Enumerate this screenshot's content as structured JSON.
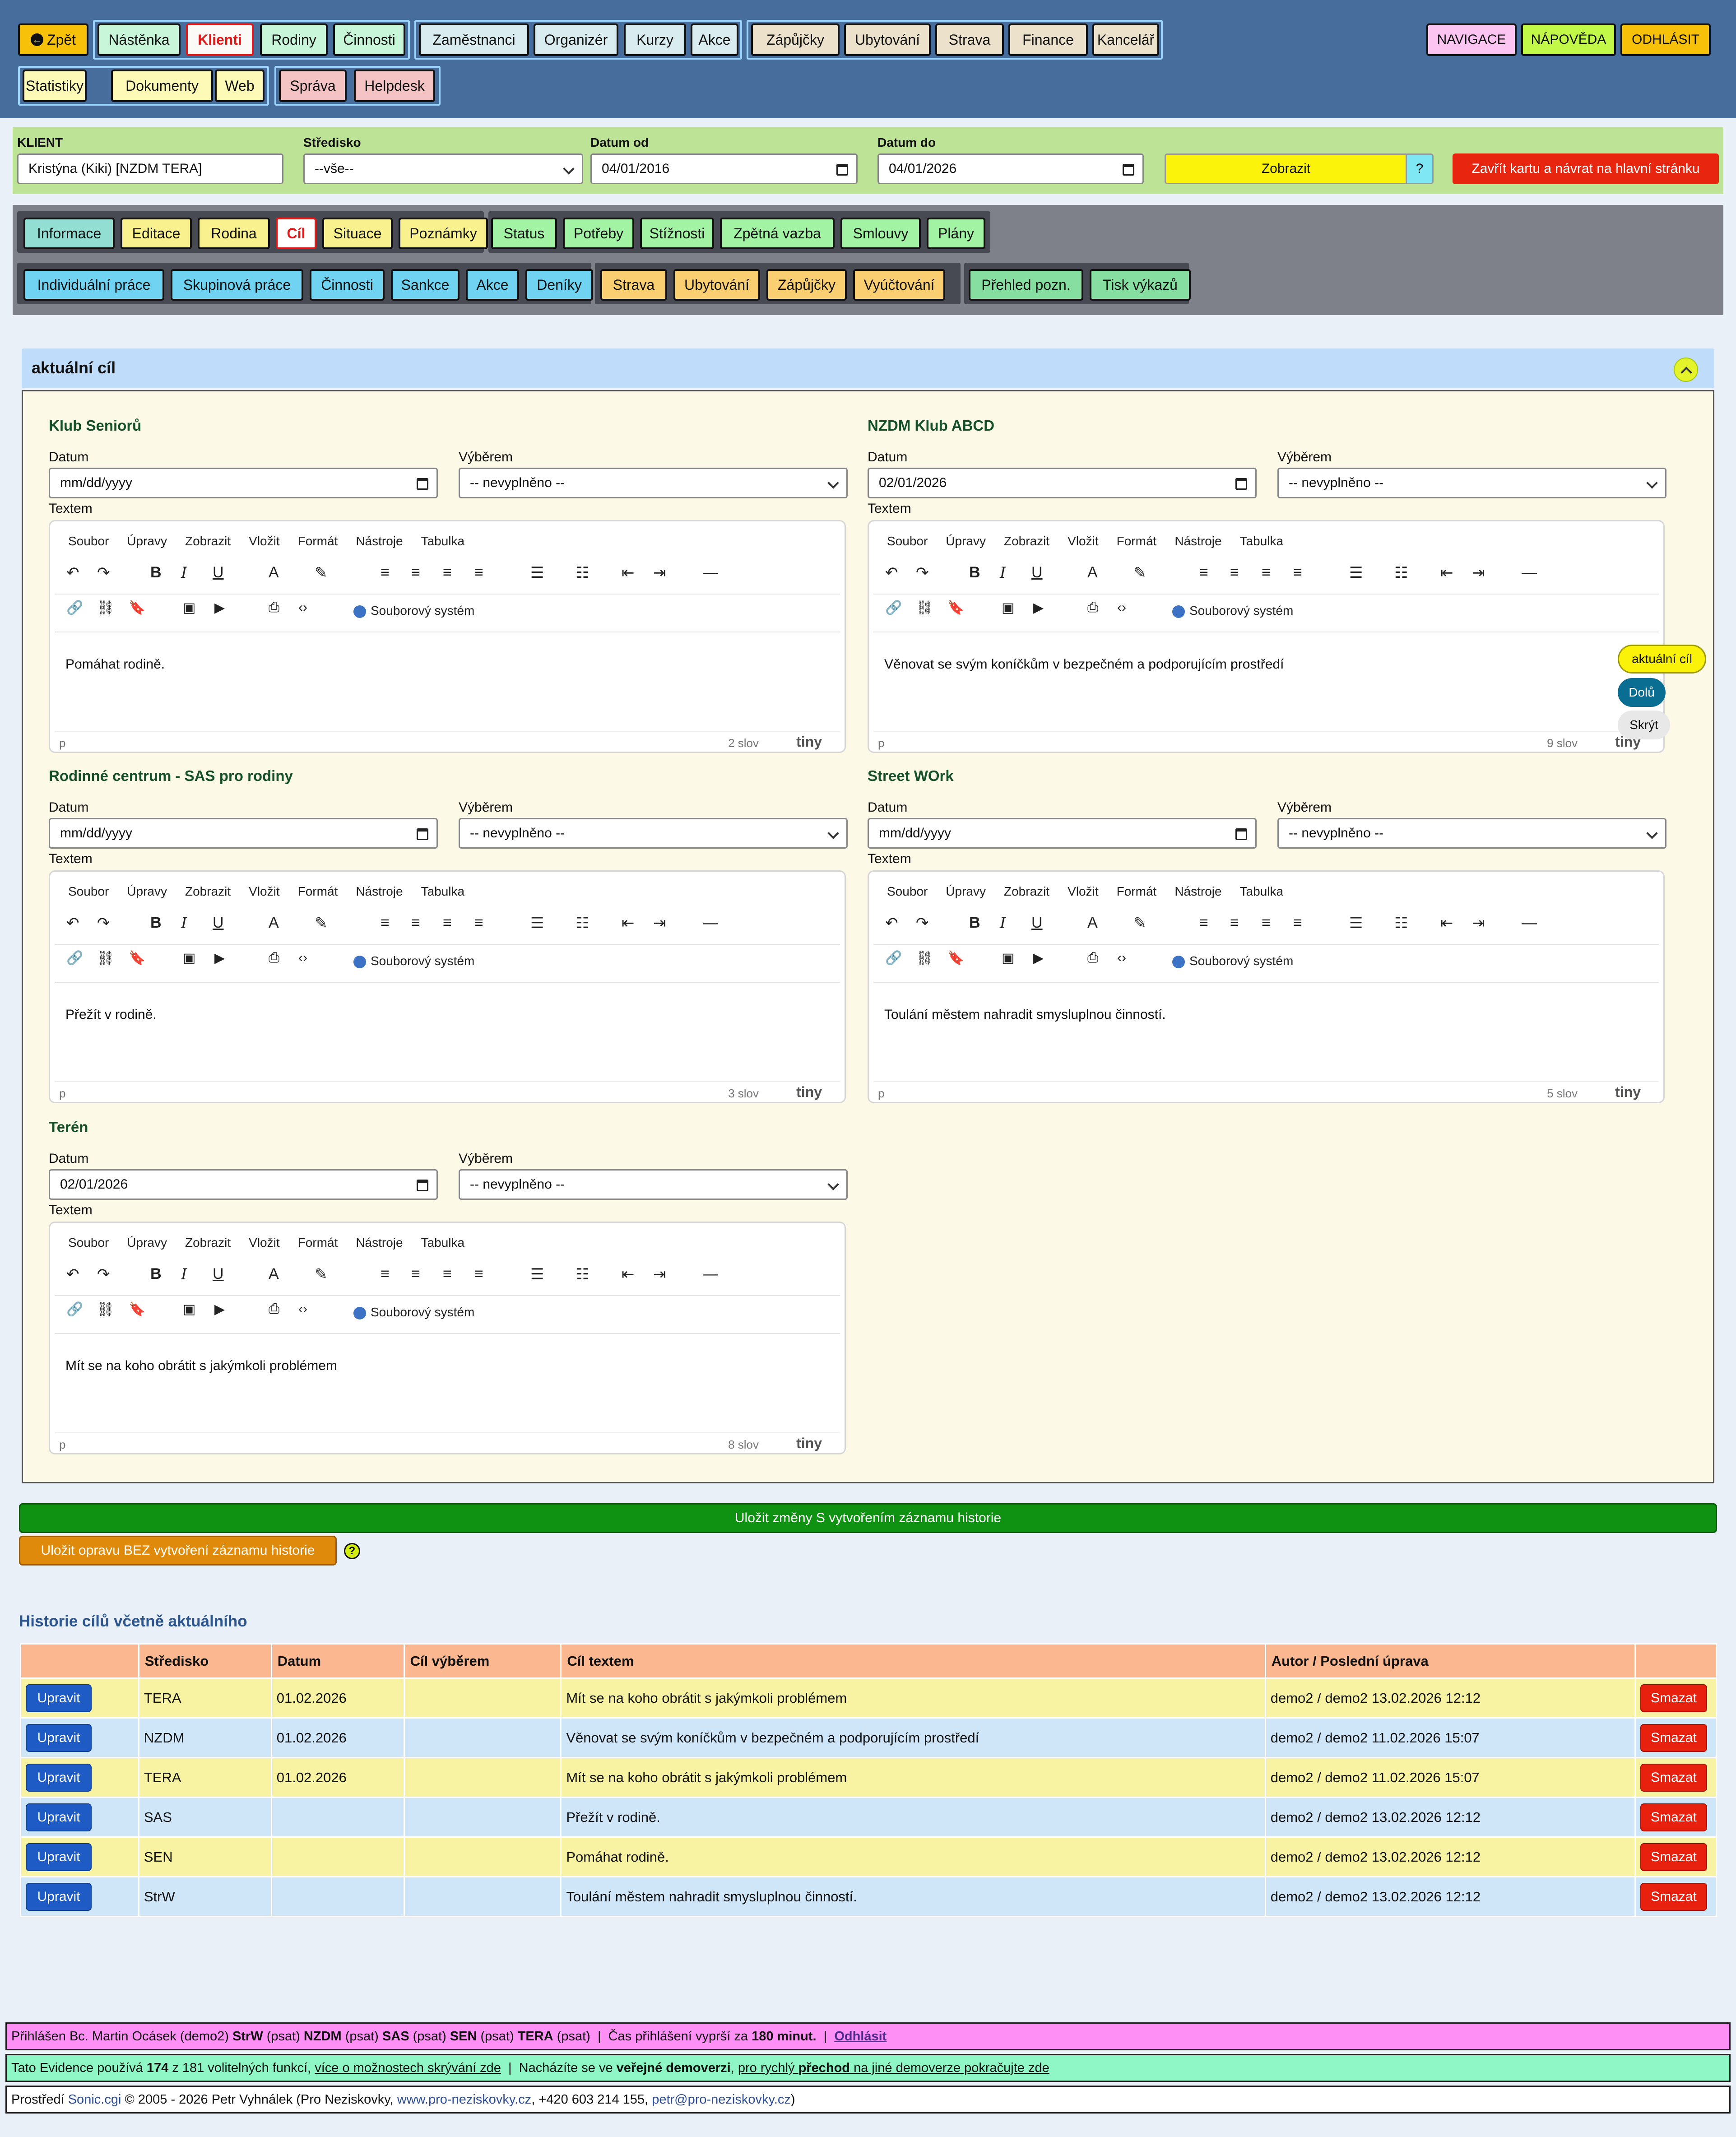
{
  "nav": {
    "back": "Zpět",
    "row1": [
      "Nástěnka",
      "Klienti",
      "Rodiny",
      "Činnosti",
      "Zaměstnanci",
      "Organizér",
      "Kurzy",
      "Akce",
      "Zápůjčky",
      "Ubytování",
      "Strava",
      "Finance",
      "Kancelář"
    ],
    "row2": [
      "Statistiky",
      "Dokumenty",
      "Web",
      "Správa",
      "Helpdesk"
    ],
    "right": [
      "NAVIGACE",
      "NÁPOVĚDA",
      "ODHLÁSIT"
    ]
  },
  "client": {
    "label_client": "KLIENT",
    "client_value": "Kristýna (Kiki) [NZDM TERA]",
    "label_center": "Středisko",
    "center_value": "--vše--",
    "label_from": "Datum od",
    "from_value": "04/01/2016",
    "label_to": "Datum do",
    "to_value": "04/01/2026",
    "show": "Zobrazit",
    "help": "?",
    "close": "Zavřít kartu a návrat na hlavní stránku"
  },
  "tabs": {
    "g1": [
      "Informace",
      "Editace",
      "Rodina",
      "Cíl",
      "Situace",
      "Poznámky"
    ],
    "g2": [
      "Status",
      "Potřeby",
      "Stížnosti",
      "Zpětná vazba",
      "Smlouvy",
      "Plány"
    ],
    "g3": [
      "Individuální práce",
      "Skupinová práce",
      "Činnosti",
      "Sankce",
      "Akce",
      "Deníky"
    ],
    "g4": [
      "Strava",
      "Ubytování",
      "Zápůjčky",
      "Vyúčtování"
    ],
    "g5": [
      "Přehled pozn.",
      "Tisk výkazů"
    ]
  },
  "panel": {
    "title": "aktuální cíl",
    "label_date": "Datum",
    "label_select": "Výběrem",
    "label_text": "Textem",
    "select_placeholder": "-- nevyplněno --",
    "date_empty": "mm/dd/yyyy",
    "editor_menus": [
      "Soubor",
      "Úpravy",
      "Zobrazit",
      "Vložit",
      "Formát",
      "Nástroje",
      "Tabulka"
    ],
    "file_system": "Souborový systém",
    "path_p": "p",
    "tiny": "tiny",
    "sections": [
      {
        "name": "Klub Seniorů",
        "date": "mm/dd/yyyy",
        "text": "Pomáhat rodině.",
        "words": "2 slov"
      },
      {
        "name": "NZDM Klub ABCD",
        "date": "02/01/2026",
        "text": "Věnovat se svým koníčkům v bezpečném a podporujícím prostředí",
        "words": "9 slov"
      },
      {
        "name": "Rodinné centrum - SAS pro rodiny",
        "date": "mm/dd/yyyy",
        "text": "Přežít v rodině.",
        "words": "3 slov"
      },
      {
        "name": "Street WOrk",
        "date": "mm/dd/yyyy",
        "text": "Toulání městem nahradit smysluplnou činností.",
        "words": "5 slov"
      },
      {
        "name": "Terén",
        "date": "02/01/2026",
        "text": "Mít se na koho obrátit s jakýmkoli problémem",
        "words": "8 slov"
      }
    ]
  },
  "float": {
    "current": "aktuální cíl",
    "down": "Dolů",
    "hide": "Skrýt"
  },
  "actions": {
    "save_history": "Uložit změny S vytvořením záznamu historie",
    "save_fix": "Uložit opravu BEZ vytvoření záznamu historie",
    "help": "?"
  },
  "history": {
    "title": "Historie cílů včetně aktuálního",
    "columns": [
      "",
      "Středisko",
      "Datum",
      "Cíl výběrem",
      "Cíl textem",
      "Autor / Poslední úprava",
      ""
    ],
    "edit": "Upravit",
    "delete": "Smazat",
    "rows": [
      {
        "center": "TERA",
        "date": "01.02.2026",
        "sel": "",
        "text": "Mít se na koho obrátit s jakýmkoli problémem",
        "author": "demo2 / demo2 13.02.2026 12:12"
      },
      {
        "center": "NZDM",
        "date": "01.02.2026",
        "sel": "",
        "text": "Věnovat se svým koníčkům v bezpečném a podporujícím prostředí",
        "author": "demo2 / demo2 11.02.2026 15:07"
      },
      {
        "center": "TERA",
        "date": "01.02.2026",
        "sel": "",
        "text": "Mít se na koho obrátit s jakýmkoli problémem",
        "author": "demo2 / demo2 11.02.2026 15:07"
      },
      {
        "center": "SAS",
        "date": "",
        "sel": "",
        "text": "Přežít v rodině.",
        "author": "demo2 / demo2 13.02.2026 12:12"
      },
      {
        "center": "SEN",
        "date": "",
        "sel": "",
        "text": "Pomáhat rodině.",
        "author": "demo2 / demo2 13.02.2026 12:12"
      },
      {
        "center": "StrW",
        "date": "",
        "sel": "",
        "text": "Toulání městem nahradit smysluplnou činností.",
        "author": "demo2 / demo2 13.02.2026 12:12"
      }
    ]
  },
  "footer": {
    "login": {
      "p1": "Přihlášen Bc. Martin Ocásek (demo2) ",
      "b1": "StrW",
      "s1": " (psat) ",
      "b2": "NZDM",
      "s2": " (psat) ",
      "b3": "SAS",
      "s3": " (psat) ",
      "b4": "SEN",
      "s4": " (psat) ",
      "b5": "TERA",
      "s5": " (psat)  |  Čas přihlášení vyprší za ",
      "b6": "180 minut.",
      "s6": "  |  ",
      "logout": "Odhlásit"
    },
    "features": {
      "p1": "Tato Evidence používá ",
      "b1": "174",
      "p2": " z 181 volitelných funkcí, ",
      "link1": "více o možnostech skrývání zde",
      "p3": "  |  Nacházíte se ve ",
      "b2": "veřejné demoverzi",
      "p4": ", ",
      "link2a": "pro rychlý ",
      "link2b": "přechod",
      "link2c": " na jiné demoverze pokračujte zde"
    },
    "copy": {
      "p1": "Prostředí ",
      "l1": "Sonic.cgi",
      "p2": " © 2005 - 2026 Petr Vyhnálek (Pro Neziskovky, ",
      "l2": "www.pro-neziskovky.cz",
      "p3": ", +420 603 214 155, ",
      "l3": "petr@pro-neziskovky.cz",
      "p4": ")"
    }
  },
  "colors": {
    "nav_bg": "#466d9b",
    "client_bg": "#bde396",
    "tab_bg": "#7e818a",
    "save_green": "#0f9212",
    "save_orange": "#df8a0a",
    "row_yellow": "#f7f3a3",
    "row_blue": "#cfe6f8"
  }
}
